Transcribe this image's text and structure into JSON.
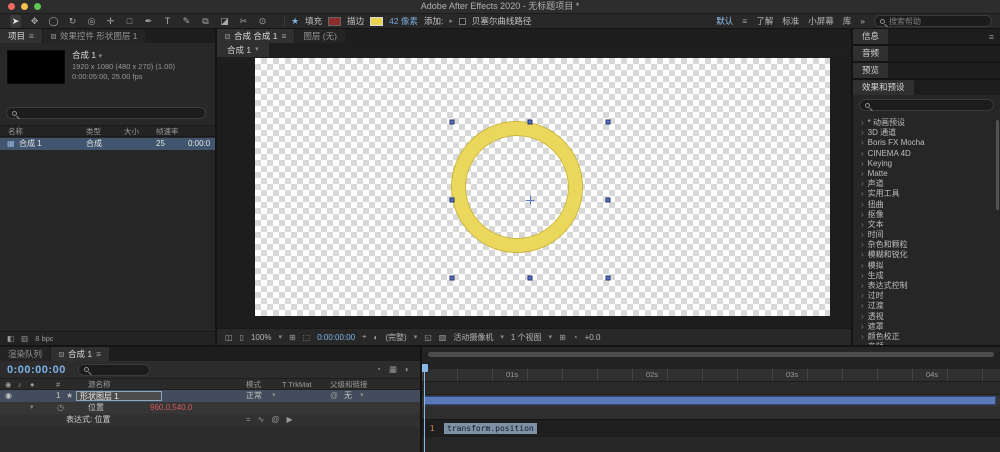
{
  "titlebar": {
    "title": "Adobe After Effects 2020 - 无标题项目 *"
  },
  "icons": {
    "menu": "≡",
    "dropdown": "▾",
    "flyout": "▸",
    "star": "★",
    "monitor": "◫",
    "monitor2": "▯",
    "grid": "⊞",
    "mask_vis": "⬚",
    "snapshot": "⌖",
    "channels": "◐",
    "roi": "◱",
    "tgrid": "▨",
    "fast_preview": "◔",
    "draft3d": "▦",
    "motion_blur": "◐",
    "eye": "◉",
    "audio": "♪",
    "solo": "●",
    "shape_layer": "★",
    "stopwatch": "◷",
    "pickwhip": "@",
    "graph": "∿",
    "equals": "=",
    "lang_menu": "▶",
    "comp": "▦",
    "footer1": "◧",
    "footer2": "▥"
  },
  "tools": [
    {
      "name": "selection",
      "glyph": "➤"
    },
    {
      "name": "hand",
      "glyph": "✥"
    },
    {
      "name": "zoom",
      "glyph": "◯"
    },
    {
      "name": "rotation",
      "glyph": "↻"
    },
    {
      "name": "camera",
      "glyph": "◎"
    },
    {
      "name": "pan-behind",
      "glyph": "✛"
    },
    {
      "name": "shape",
      "glyph": "□"
    },
    {
      "name": "pen",
      "glyph": "✒"
    },
    {
      "name": "type",
      "glyph": "T"
    },
    {
      "name": "brush",
      "glyph": "✎"
    },
    {
      "name": "clone-stamp",
      "glyph": "⧉"
    },
    {
      "name": "eraser",
      "glyph": "◪"
    },
    {
      "name": "roto-brush",
      "glyph": "✂"
    },
    {
      "name": "puppet",
      "glyph": "⊙"
    }
  ],
  "toolbar": {
    "fill_label": "填充",
    "stroke_label": "描边",
    "stroke_width": "42 像素",
    "add_label": "添加:",
    "bezier_label": "贝塞尔曲线路径",
    "workspaces": [
      "默认",
      "了解",
      "标准",
      "小屏幕",
      "库"
    ],
    "overflow": "»",
    "search_placeholder": "搜索帮助"
  },
  "project": {
    "tab_project": "项目",
    "tab_effect_controls": "效果控件 形状图层 1",
    "comp_name": "合成 1",
    "meta_line1": "1920 x 1080 (480 x 270) (1.00)",
    "meta_line2": "0:00:05:00, 25.00 fps",
    "columns": [
      "名称",
      "类型",
      "大小",
      "帧速率"
    ],
    "row": {
      "name": "合成 1",
      "type": "合成",
      "rate": "25",
      "in_point": "0:00:0"
    },
    "bit_depth": "8 bpc"
  },
  "viewer": {
    "tab_comp": "合成 合成 1",
    "tab_layer": "图层 (无)",
    "comp_tab": "合成 1",
    "zoom": "100%",
    "time": "0:00:00:00",
    "resolution": "(完整)",
    "camera": "活动摄像机",
    "views": "1 个视图",
    "exposure": "+0.0"
  },
  "panels": {
    "info_title": "信息",
    "audio_title": "音频",
    "preview_title": "预览",
    "effects_title": "效果和预设",
    "effects_categories": [
      "* 动画预设",
      "3D 通道",
      "Boris FX Mocha",
      "CINEMA 4D",
      "Keying",
      "Matte",
      "声道",
      "实用工具",
      "扭曲",
      "抠像",
      "文本",
      "时间",
      "杂色和颗粒",
      "模糊和锐化",
      "模拟",
      "生成",
      "表达式控制",
      "过时",
      "过渡",
      "透视",
      "遮罩",
      "颜色校正",
      "音频"
    ]
  },
  "timeline": {
    "tab_render_queue": "渲染队列",
    "tab_comp": "合成 1",
    "time": "0:00:00:00",
    "col_hash": "#",
    "col_source_name": "源名称",
    "col_mode": "模式",
    "col_trkmat": "T TrkMat",
    "col_parent": "父级和链接",
    "layer_index": "1",
    "layer_name": "形状图层 1",
    "layer_mode": "正常",
    "layer_parent": "无",
    "prop_name": "位置",
    "prop_value": "960.0,540.0",
    "expression_label": "表达式: 位置",
    "expression_code": "transform.position",
    "line_number": "1",
    "ruler_labels": [
      "01s",
      "02s",
      "03s",
      "04s"
    ]
  }
}
